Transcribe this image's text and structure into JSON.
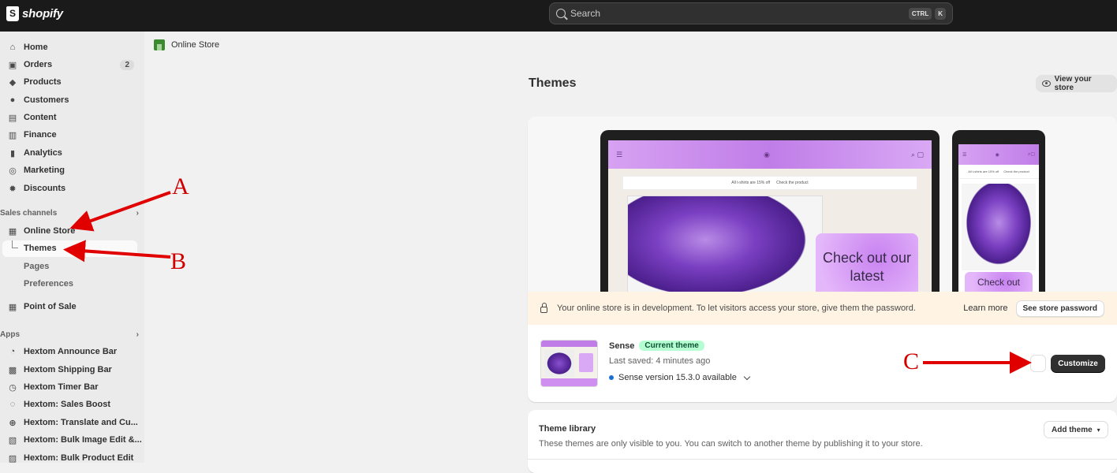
{
  "topbar": {
    "brand": "shopify",
    "search_placeholder": "Search",
    "shortcut_keys": [
      "CTRL",
      "K"
    ]
  },
  "sidebar": {
    "items": [
      {
        "label": "Home",
        "icon": "home-icon"
      },
      {
        "label": "Orders",
        "icon": "orders-icon",
        "badge": "2"
      },
      {
        "label": "Products",
        "icon": "tag-icon"
      },
      {
        "label": "Customers",
        "icon": "person-icon"
      },
      {
        "label": "Content",
        "icon": "content-icon"
      },
      {
        "label": "Finance",
        "icon": "bank-icon"
      },
      {
        "label": "Analytics",
        "icon": "bar-chart-icon"
      },
      {
        "label": "Marketing",
        "icon": "target-icon"
      },
      {
        "label": "Discounts",
        "icon": "discount-icon"
      }
    ],
    "sales_channels_label": "Sales channels",
    "online_store": "Online Store",
    "themes": "Themes",
    "pages": "Pages",
    "preferences": "Preferences",
    "point_of_sale": "Point of Sale",
    "apps_label": "Apps",
    "apps": [
      "Hextom Announce Bar",
      "Hextom Shipping Bar",
      "Hextom Timer Bar",
      "Hextom: Sales Boost",
      "Hextom: Translate and Cu...",
      "Hextom: Bulk Image Edit &...",
      "Hextom: Bulk Product Edit"
    ]
  },
  "breadcrumb": "Online Store",
  "page": {
    "title": "Themes",
    "view_store": "View your store"
  },
  "preview": {
    "announcement": "All t-shirts are 15% off",
    "announcement_link": "Check the product",
    "promo_text": "Check out our latest",
    "phone_announcement": "All t-shirts are 15% off",
    "phone_promo_text": "Check out"
  },
  "banner": {
    "text": "Your online store is in development. To let visitors access your store, give them the password.",
    "learn_more": "Learn more",
    "button": "See store password"
  },
  "current_theme": {
    "name": "Sense",
    "badge": "Current theme",
    "last_saved": "Last saved: 4 minutes ago",
    "version": "Sense version 15.3.0 available",
    "customize": "Customize"
  },
  "library": {
    "title": "Theme library",
    "description": "These themes are only visible to you. You can switch to another theme by publishing it to your store.",
    "add_theme": "Add theme"
  },
  "annotations": {
    "a": "A",
    "b": "B",
    "c": "C",
    "color": "#e00000"
  }
}
